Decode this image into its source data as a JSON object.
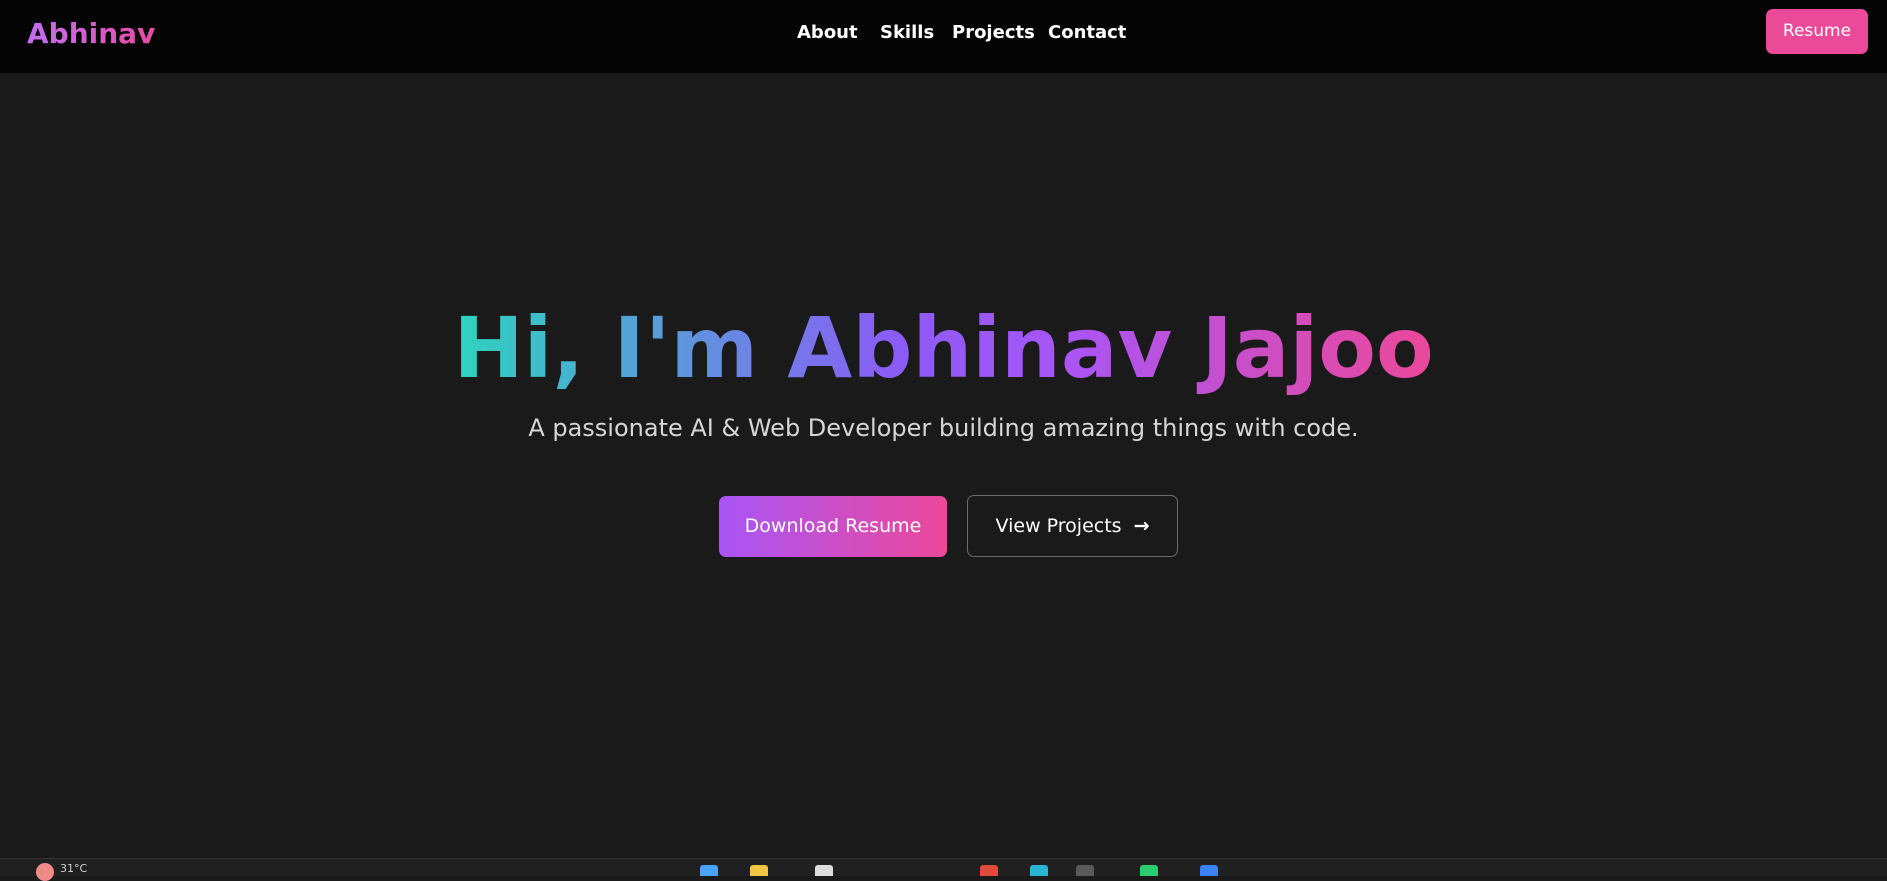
{
  "brand": {
    "logo_text": "Abhinav",
    "colors": [
      "#c26ff2",
      "#e74aa4"
    ]
  },
  "nav": {
    "items": [
      {
        "label": "About"
      },
      {
        "label": "Skills"
      },
      {
        "label": "Projects"
      },
      {
        "label": "Contact"
      }
    ],
    "resume_label": "Resume"
  },
  "hero": {
    "title": "Hi, I'm Abhinav Jajoo",
    "subtitle": "A passionate AI & Web Developer building amazing things with code.",
    "download_label": "Download Resume",
    "view_label": "View Projects",
    "view_icon": "arrow-right-icon"
  },
  "colors": {
    "background": "#1a1a1a",
    "navbar": "#050505",
    "accent_pink": "#ec4899",
    "accent_purple": "#a855f7",
    "accent_teal": "#2dd4bf"
  },
  "taskbar": {
    "weather_text": "31°C",
    "weather_icon": "weather-icon",
    "app_icons": [
      "app-icon-1",
      "app-icon-2",
      "app-icon-3",
      "app-icon-4",
      "app-icon-5",
      "app-icon-6",
      "app-icon-7",
      "app-icon-8"
    ]
  }
}
